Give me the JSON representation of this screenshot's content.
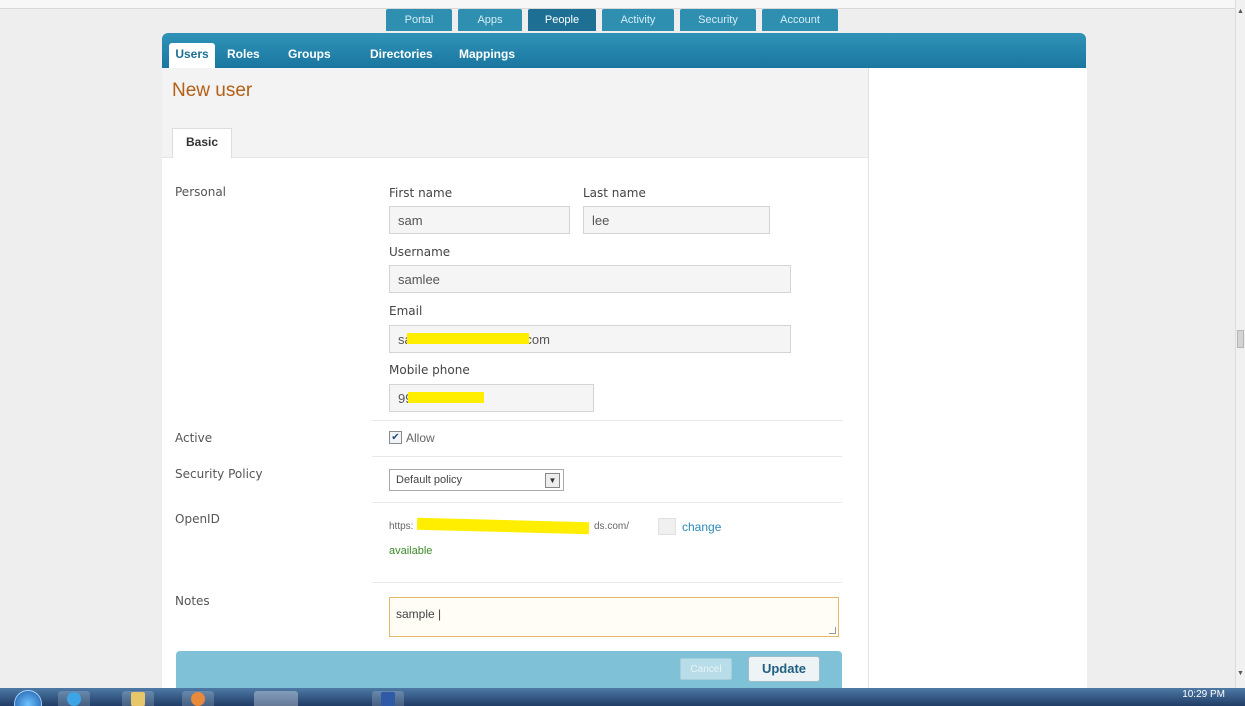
{
  "top_nav": {
    "tabs": [
      {
        "label": "Portal",
        "active": false
      },
      {
        "label": "Apps",
        "active": false
      },
      {
        "label": "People",
        "active": true
      },
      {
        "label": "Activity",
        "active": false
      },
      {
        "label": "Security",
        "active": false
      },
      {
        "label": "Account",
        "active": false
      }
    ]
  },
  "sub_nav": {
    "tabs": [
      {
        "label": "Users",
        "active": true
      },
      {
        "label": "Roles",
        "active": false
      },
      {
        "label": "Groups",
        "active": false
      },
      {
        "label": "Directories",
        "active": false
      },
      {
        "label": "Mappings",
        "active": false
      }
    ]
  },
  "page": {
    "title": "New user",
    "form_tab": "Basic"
  },
  "personal": {
    "section_label": "Personal",
    "first_name_label": "First name",
    "first_name_value": "sam",
    "last_name_label": "Last name",
    "last_name_value": "lee",
    "username_label": "Username",
    "username_value": "samlee",
    "email_label": "Email",
    "email_prefix": "sa",
    "email_suffix": ".com",
    "mobile_label": "Mobile phone",
    "mobile_prefix": "99"
  },
  "active": {
    "label": "Active",
    "checkbox_label": "Allow",
    "checked": true
  },
  "security_policy": {
    "label": "Security Policy",
    "selected": "Default policy"
  },
  "openid": {
    "label": "OpenID",
    "url_prefix": "https:",
    "url_suffix": "ds.com/",
    "change_link": "change",
    "status": "available"
  },
  "notes": {
    "label": "Notes",
    "value": "sample |"
  },
  "actions": {
    "cancel_label": "Cancel",
    "update_label": "Update"
  },
  "taskbar": {
    "clock": "10:29 PM"
  },
  "colors": {
    "accent": "#1d6f94",
    "title": "#b35f14",
    "redaction": "#ffee00",
    "link": "#2c8ab8",
    "available": "#3b8a2a"
  }
}
